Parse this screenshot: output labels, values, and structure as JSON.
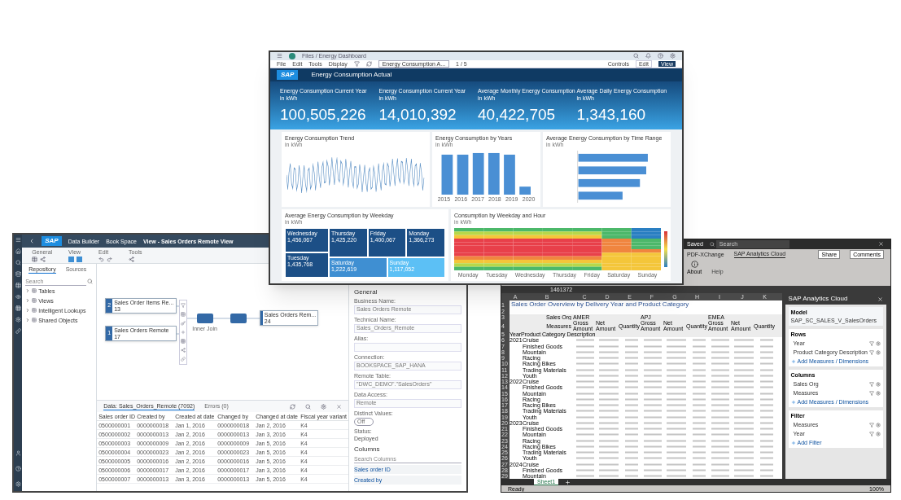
{
  "dashboard": {
    "breadcrumb": "Files / Energy Dashboard",
    "menus": [
      "File",
      "Edit",
      "Tools",
      "Display"
    ],
    "page_select": "Energy Consumption A...",
    "page_count": "1 / 5",
    "controls": "Controls",
    "modes": [
      {
        "label": "Edit",
        "selected": false
      },
      {
        "label": "View",
        "selected": true
      }
    ],
    "logo": "SAP",
    "title": "Energy Consumption Actual",
    "kpis": [
      {
        "title": "Energy Consumption Current Year",
        "unit": "in kWh",
        "value": "100,505,226"
      },
      {
        "title": "Energy Consumption Current Year",
        "unit": "in kWh",
        "value": "14,010,392"
      },
      {
        "title": "Average Monthly Energy Consumption",
        "unit": "in kWh",
        "value": "40,422,705"
      },
      {
        "title": "Average Daily Energy Consumption",
        "unit": "in kWh",
        "value": "1,343,160"
      }
    ],
    "trend": {
      "title": "Energy Consumption Trend",
      "unit": "in kWh"
    },
    "years": {
      "title": "Energy Consumption by Years",
      "unit": "in kWh",
      "categories": [
        "2015",
        "2016",
        "2017",
        "2018",
        "2019",
        "2020"
      ]
    },
    "time_range": {
      "title": "Average Energy Consumption by Time Range",
      "unit": "in kWh"
    },
    "weekday": {
      "title": "Average Energy Consumption by Weekday",
      "unit": "in kWh",
      "tiles": [
        {
          "day": "Wednesday",
          "value": "1,456,067"
        },
        {
          "day": "Thursday",
          "value": "1,425,220"
        },
        {
          "day": "Friday",
          "value": "1,400,067"
        },
        {
          "day": "Monday",
          "value": "1,366,273"
        },
        {
          "day": "Tuesday",
          "value": "1,435,768"
        },
        {
          "day": "Saturday",
          "value": "1,222,619"
        },
        {
          "day": "Sunday",
          "value": "1,117,052"
        }
      ]
    },
    "heatmap": {
      "title": "Consumption by Weekday and Hour",
      "unit": "in kWh",
      "days": [
        "Monday",
        "Tuesday",
        "Wednesday",
        "Thursday",
        "Friday",
        "Saturday",
        "Sunday"
      ]
    }
  },
  "builder": {
    "logo": "SAP",
    "crumbs": [
      "Data Builder",
      "Book Space",
      "View - Sales Orders Remote View"
    ],
    "toolbar_groups": [
      "General",
      "View",
      "Edit",
      "Tools"
    ],
    "tabs": [
      {
        "label": "Repository",
        "selected": true
      },
      {
        "label": "Sources",
        "selected": false
      }
    ],
    "search": {
      "placeholder": "Search"
    },
    "tree": [
      {
        "label": "Tables",
        "expanded": false
      },
      {
        "label": "Views",
        "expanded": false
      },
      {
        "label": "Intelligent Lookups",
        "expanded": false
      },
      {
        "label": "Shared Objects",
        "expanded": false
      }
    ],
    "sources": [
      {
        "number": "2",
        "title": "Sales Order Items Re...",
        "count": "13"
      },
      {
        "number": "1",
        "title": "Sales Orders Remote",
        "count": "17"
      }
    ],
    "join_label": "Inner Join",
    "output": {
      "title": "Sales Orders Rem...",
      "count": "24"
    },
    "data_tabs": [
      {
        "label": "Data: Sales_Orders_Remote (7092)",
        "selected": true
      },
      {
        "label": "Errors (0)",
        "selected": false
      }
    ],
    "columns": [
      "Sales order ID",
      "Created by",
      "Created at date",
      "Changed by",
      "Changed at date",
      "Fiscal year variant"
    ],
    "rows": [
      [
        "0500000001",
        "0000000018",
        "Jan 1, 2016",
        "0000000018",
        "Jan 2, 2016",
        "K4"
      ],
      [
        "0500000002",
        "0000000013",
        "Jan 2, 2016",
        "0000000013",
        "Jan 3, 2016",
        "K4"
      ],
      [
        "0500000003",
        "0000000009",
        "Jan 2, 2016",
        "0000000009",
        "Jan 5, 2016",
        "K4"
      ],
      [
        "0500000004",
        "0000000023",
        "Jan 2, 2016",
        "0000000023",
        "Jan 5, 2016",
        "K4"
      ],
      [
        "0500000005",
        "0000000016",
        "Jan 2, 2016",
        "0000000016",
        "Jan 5, 2016",
        "K4"
      ],
      [
        "0500000006",
        "0000000017",
        "Jan 2, 2016",
        "0000000017",
        "Jan 3, 2016",
        "K4"
      ],
      [
        "0500000007",
        "0000000013",
        "Jan 3, 2016",
        "0000000013",
        "Jan 5, 2016",
        "K4"
      ]
    ],
    "properties": {
      "section": "General",
      "fields": [
        {
          "kind": "field",
          "label": "Business Name:",
          "value": "Sales Orders Remote"
        },
        {
          "kind": "field",
          "label": "Technical Name:",
          "value": "Sales_Orders_Remote"
        },
        {
          "kind": "field",
          "label": "Alias:"
        },
        {
          "kind": "field",
          "label": "Connection:",
          "value": "BOOKSPACE_SAP_HANA"
        },
        {
          "kind": "field",
          "label": "Remote Table:",
          "value": "\"DWC_DEMO\".\"SalesOrders\""
        },
        {
          "kind": "field",
          "label": "Data Access:",
          "value": "Remote"
        },
        {
          "kind": "toggle",
          "label": "Distinct Values:",
          "value": "Off",
          "on": false
        },
        {
          "kind": "status",
          "label": "Status:",
          "value": "Deployed"
        }
      ],
      "columns_title": "Columns",
      "columns_search": {
        "placeholder": "Search Columns"
      },
      "column_items": [
        "Sales order ID",
        "Created by"
      ]
    }
  },
  "excel": {
    "saved": "Saved",
    "search": {
      "placeholder": "Search"
    },
    "ribbon_tabs": [
      {
        "label": "PDF-XChange",
        "selected": false
      },
      {
        "label": "SAP Analytics Cloud",
        "selected": true
      }
    ],
    "share": "Share",
    "comments": "Comments",
    "about": "About",
    "group": "Help",
    "formula": "1461372",
    "letters": [
      "A",
      "B",
      "C",
      "D",
      "E",
      "F",
      "G",
      "H",
      "I",
      "J",
      "K"
    ],
    "row_numbers": [
      "1",
      "2",
      "3",
      "4",
      "5",
      "6",
      "7",
      "8",
      "9",
      "10",
      "11",
      "12",
      "13",
      "14",
      "15",
      "16",
      "17",
      "18",
      "19",
      "20",
      "21",
      "22",
      "23",
      "24",
      "25",
      "26",
      "27",
      "28",
      "29"
    ],
    "sheet_title": "Sales Order Overview by Delivery Year and Product Category",
    "sales_org_label": "Sales Org",
    "orgs": [
      "AMER",
      "APJ",
      "EMEA"
    ],
    "measures_label": "Measures",
    "measures": [
      "Gross Amount",
      "Net Amount",
      "Quantity",
      "Gross Amount",
      "Net Amount",
      "Quantity",
      "Gross Amount",
      "Net Amount",
      "Quantity"
    ],
    "year_header": "Year",
    "category_header": "Product Category Description",
    "rows": [
      {
        "year": "2021",
        "category": "Cruise"
      },
      {
        "category": "Finished Goods"
      },
      {
        "category": "Mountain"
      },
      {
        "category": "Racing"
      },
      {
        "category": "Racing Bikes"
      },
      {
        "category": "Trading Materials"
      },
      {
        "category": "Youth"
      },
      {
        "year": "2022",
        "category": "Cruise"
      },
      {
        "category": "Finished Goods"
      },
      {
        "category": "Mountain"
      },
      {
        "category": "Racing"
      },
      {
        "category": "Racing Bikes"
      },
      {
        "category": "Trading Materials"
      },
      {
        "category": "Youth"
      },
      {
        "year": "2023",
        "category": "Cruise"
      },
      {
        "category": "Finished Goods"
      },
      {
        "category": "Mountain"
      },
      {
        "category": "Racing"
      },
      {
        "category": "Racing Bikes"
      },
      {
        "category": "Trading Materials"
      },
      {
        "category": "Youth"
      },
      {
        "year": "2024",
        "category": "Cruise"
      },
      {
        "category": "Finished Goods"
      },
      {
        "category": "Mountain"
      }
    ],
    "sheet_tab": "Sheet1",
    "status": "Ready",
    "zoom": "100%",
    "panel": {
      "title": "SAP Analytics Cloud",
      "model_label": "Model",
      "model": "SAP_SC_SALES_V_SalesOrders",
      "sections": [
        {
          "title": "Rows",
          "items": [
            "Year",
            "Product Category Description"
          ],
          "add": "Add Measures / Dimensions"
        },
        {
          "title": "Columns",
          "items": [
            "Sales Org",
            "Measures"
          ],
          "add": "Add Measures / Dimensions"
        },
        {
          "title": "Filter",
          "items": [
            "Measures",
            "Year"
          ],
          "add": "Add Filter"
        }
      ]
    }
  }
}
